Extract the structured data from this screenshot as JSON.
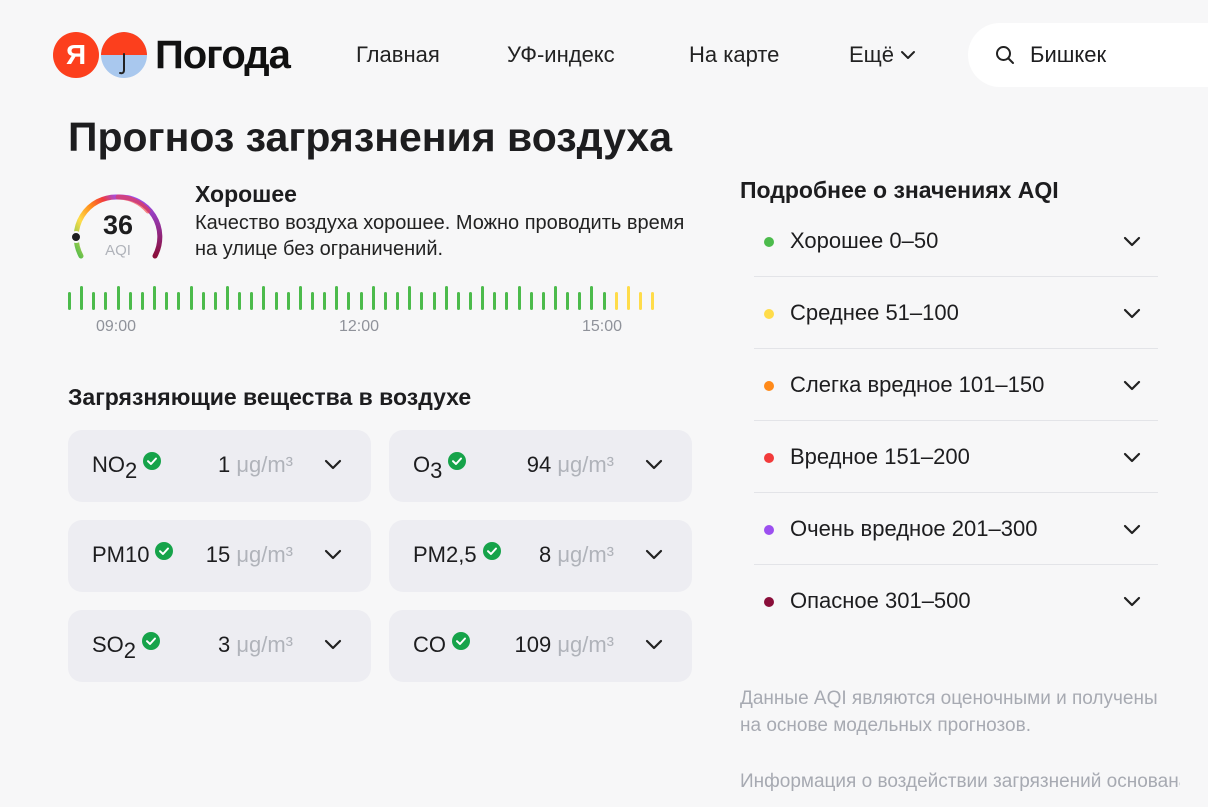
{
  "header": {
    "logo_letter": "Я",
    "logo_text": "Погода",
    "nav": [
      {
        "label": "Главная"
      },
      {
        "label": "УФ-индекс"
      },
      {
        "label": "На карте"
      },
      {
        "label": "Ещё"
      }
    ],
    "search_value": "Бишкек"
  },
  "page_title": "Прогноз загрязнения воздуха",
  "current": {
    "aqi": "36",
    "aqi_unit": "AQI",
    "aqi_fraction": 0.12,
    "status": "Хорошее",
    "description": "Качество воздуха хорошее. Можно проводить время на улице без ограничений."
  },
  "timeline": {
    "labels": [
      "09:00",
      "12:00",
      "15:00"
    ],
    "levels": [
      "good",
      "good",
      "good",
      "good",
      "good",
      "good",
      "good",
      "good",
      "good",
      "good",
      "good",
      "good",
      "good",
      "good",
      "good",
      "good",
      "good",
      "good",
      "good",
      "good",
      "good",
      "good",
      "good",
      "good",
      "good",
      "good",
      "good",
      "good",
      "good",
      "good",
      "good",
      "good",
      "good",
      "good",
      "good",
      "good",
      "good",
      "good",
      "good",
      "good",
      "good",
      "good",
      "good",
      "good",
      "good",
      "moderate",
      "moderate",
      "moderate",
      "moderate"
    ]
  },
  "pollutants_title": "Загрязняющие вещества в воздухе",
  "pollutants": [
    {
      "name": "NO",
      "sub": "2",
      "value": "1",
      "unit": "μg/m³"
    },
    {
      "name": "O",
      "sub": "3",
      "value": "94",
      "unit": "μg/m³"
    },
    {
      "name": "PM10",
      "sub": "",
      "value": "15",
      "unit": "μg/m³"
    },
    {
      "name": "PM2,5",
      "sub": "",
      "value": "8",
      "unit": "μg/m³"
    },
    {
      "name": "SO",
      "sub": "2",
      "value": "3",
      "unit": "μg/m³"
    },
    {
      "name": "CO",
      "sub": "",
      "value": "109",
      "unit": "μg/m³"
    }
  ],
  "aqi_info": {
    "title": "Подробнее о значениях AQI",
    "levels": [
      {
        "label": "Хорошее 0–50",
        "color": "#4cbb4c"
      },
      {
        "label": "Среднее 51–100",
        "color": "#ffdc4a"
      },
      {
        "label": "Слегка вредное 101–150",
        "color": "#ff8a1a"
      },
      {
        "label": "Вредное 151–200",
        "color": "#f23b3b"
      },
      {
        "label": "Очень вредное 201–300",
        "color": "#9c4ff0"
      },
      {
        "label": "Опасное 301–500",
        "color": "#8a0e3a"
      }
    ],
    "note1": "Данные AQI являются оценочными и получены на основе модельных прогнозов.",
    "note2": "Информация о воздействии загрязнений основана на данных «Всемирной"
  },
  "colors": {
    "good": "#4cbb4c",
    "moderate": "#ffdc4a",
    "check": "#16a34a",
    "brand": "#fc3f1d"
  }
}
